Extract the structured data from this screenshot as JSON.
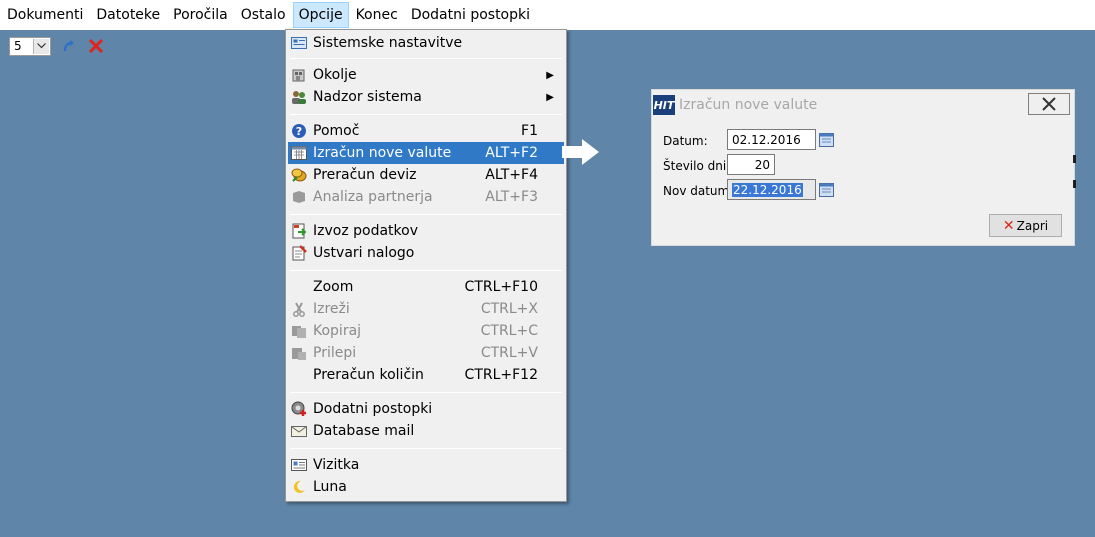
{
  "menubar": {
    "items": [
      "Dokumenti",
      "Datoteke",
      "Poročila",
      "Ostalo",
      "Opcije",
      "Konec",
      "Dodatni postopki"
    ]
  },
  "toolbar": {
    "combo_value": "5"
  },
  "dropdown": {
    "items": [
      {
        "label": "Sistemske nastavitve",
        "shortcut": "",
        "icon": "settings-icon"
      },
      {
        "label": "Okolje",
        "shortcut": "",
        "icon": "environment-icon",
        "submenu": true
      },
      {
        "label": "Nadzor sistema",
        "shortcut": "",
        "icon": "users-icon",
        "submenu": true
      },
      {
        "label": "Pomoč",
        "shortcut": "F1",
        "icon": "help-icon"
      },
      {
        "label": "Izračun nove valute",
        "shortcut": "ALT+F2",
        "icon": "calendar-icon",
        "highlight": true
      },
      {
        "label": "Preračun deviz",
        "shortcut": "ALT+F4",
        "icon": "currency-icon"
      },
      {
        "label": "Analiza partnerja",
        "shortcut": "ALT+F3",
        "icon": "partner-icon",
        "disabled": true
      },
      {
        "label": "Izvoz podatkov",
        "shortcut": "",
        "icon": "export-icon"
      },
      {
        "label": "Ustvari nalogo",
        "shortcut": "",
        "icon": "task-icon"
      },
      {
        "label": "Zoom",
        "shortcut": "CTRL+F10",
        "icon": ""
      },
      {
        "label": "Izreži",
        "shortcut": "CTRL+X",
        "icon": "cut-icon",
        "disabled": true
      },
      {
        "label": "Kopiraj",
        "shortcut": "CTRL+C",
        "icon": "copy-icon",
        "disabled": true
      },
      {
        "label": "Prilepi",
        "shortcut": "CTRL+V",
        "icon": "paste-icon",
        "disabled": true
      },
      {
        "label": "Preračun količin",
        "shortcut": "CTRL+F12",
        "icon": ""
      },
      {
        "label": "Dodatni postopki",
        "shortcut": "",
        "icon": "procedures-icon"
      },
      {
        "label": "Database mail",
        "shortcut": "",
        "icon": "mail-icon"
      },
      {
        "label": "Vizitka",
        "shortcut": "",
        "icon": "business-card-icon"
      },
      {
        "label": "Luna",
        "shortcut": "",
        "icon": "moon-icon"
      }
    ]
  },
  "dialog": {
    "title": "Izračun nove valute",
    "logo": "HIT",
    "datum_label": "Datum:",
    "datum_value": "02.12.2016",
    "stevilo_label": "Število dni:",
    "stevilo_value": "20",
    "nov_datum_label": "Nov datum:",
    "nov_datum_value": "22.12.2016",
    "close_button_label": "Zapri"
  },
  "colors": {
    "desktop": "#5f85a8",
    "highlight": "#2f79c6",
    "active_menu": "#cce8ff"
  }
}
